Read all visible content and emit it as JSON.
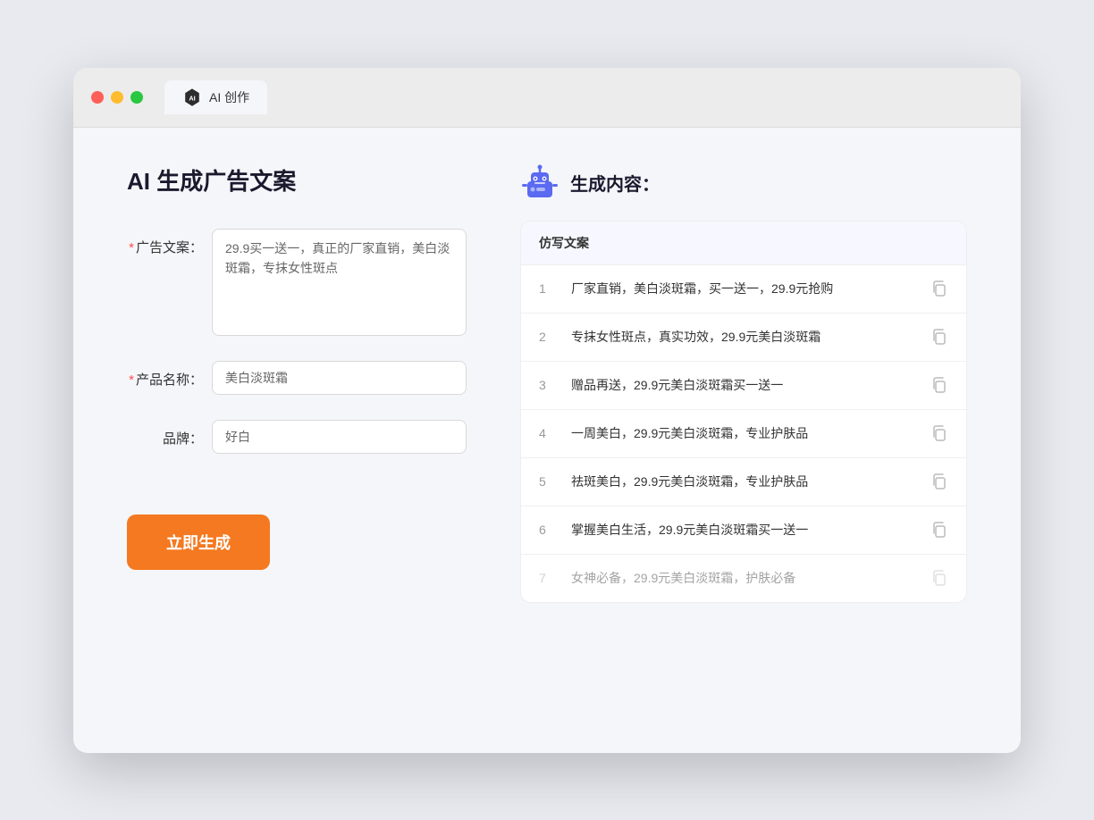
{
  "window": {
    "tab_label": "AI 创作"
  },
  "left_panel": {
    "page_title": "AI 生成广告文案",
    "fields": [
      {
        "id": "ad_copy",
        "label": "广告文案：",
        "required": true,
        "type": "textarea",
        "value": "29.9买一送一，真正的厂家直销，美白淡斑霜，专抹女性斑点"
      },
      {
        "id": "product_name",
        "label": "产品名称：",
        "required": true,
        "type": "input",
        "value": "美白淡斑霜"
      },
      {
        "id": "brand",
        "label": "品牌：",
        "required": false,
        "type": "input",
        "value": "好白"
      }
    ],
    "generate_button": "立即生成"
  },
  "right_panel": {
    "title": "生成内容：",
    "table_header": "仿写文案",
    "results": [
      {
        "num": "1",
        "text": "厂家直销，美白淡斑霜，买一送一，29.9元抢购",
        "faded": false
      },
      {
        "num": "2",
        "text": "专抹女性斑点，真实功效，29.9元美白淡斑霜",
        "faded": false
      },
      {
        "num": "3",
        "text": "赠品再送，29.9元美白淡斑霜买一送一",
        "faded": false
      },
      {
        "num": "4",
        "text": "一周美白，29.9元美白淡斑霜，专业护肤品",
        "faded": false
      },
      {
        "num": "5",
        "text": "祛斑美白，29.9元美白淡斑霜，专业护肤品",
        "faded": false
      },
      {
        "num": "6",
        "text": "掌握美白生活，29.9元美白淡斑霜买一送一",
        "faded": false
      },
      {
        "num": "7",
        "text": "女神必备，29.9元美白淡斑霜，护肤必备",
        "faded": true
      }
    ]
  }
}
